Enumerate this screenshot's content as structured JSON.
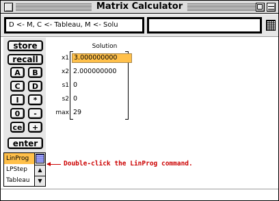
{
  "window": {
    "title": "Matrix Calculator"
  },
  "topbar": {
    "command_text": "D <- M, C <- Tableau, M <- Solu",
    "entry_value": ""
  },
  "keypad": {
    "store": "store",
    "recall": "recall",
    "keys": [
      [
        "A",
        "B"
      ],
      [
        "C",
        "D"
      ],
      [
        "I",
        "*"
      ],
      [
        "0",
        "-"
      ],
      [
        "ce",
        "+"
      ]
    ],
    "enter": "enter"
  },
  "command_list": {
    "items": [
      "LinProg",
      "LPStep",
      "Tableau"
    ],
    "selected": "LinProg"
  },
  "solution": {
    "header": "Solution",
    "rows": [
      {
        "label": "x1",
        "value": "3.000000000",
        "selected": true
      },
      {
        "label": "x2",
        "value": "2.000000000"
      },
      {
        "label": "s1",
        "value": "0"
      },
      {
        "label": "s2",
        "value": "0"
      },
      {
        "label": "max",
        "value": "29"
      }
    ]
  },
  "annotation": {
    "text": "Double-click the LinProg command.",
    "color": "#cc0000"
  },
  "colors": {
    "selection": "#ffc04a",
    "annotation": "#cc0000"
  },
  "icons": [
    "close-box-icon",
    "zoom-box-icon",
    "collapse-box-icon",
    "grid-icon",
    "scroll-up-arrow-icon",
    "scroll-down-arrow-icon"
  ]
}
